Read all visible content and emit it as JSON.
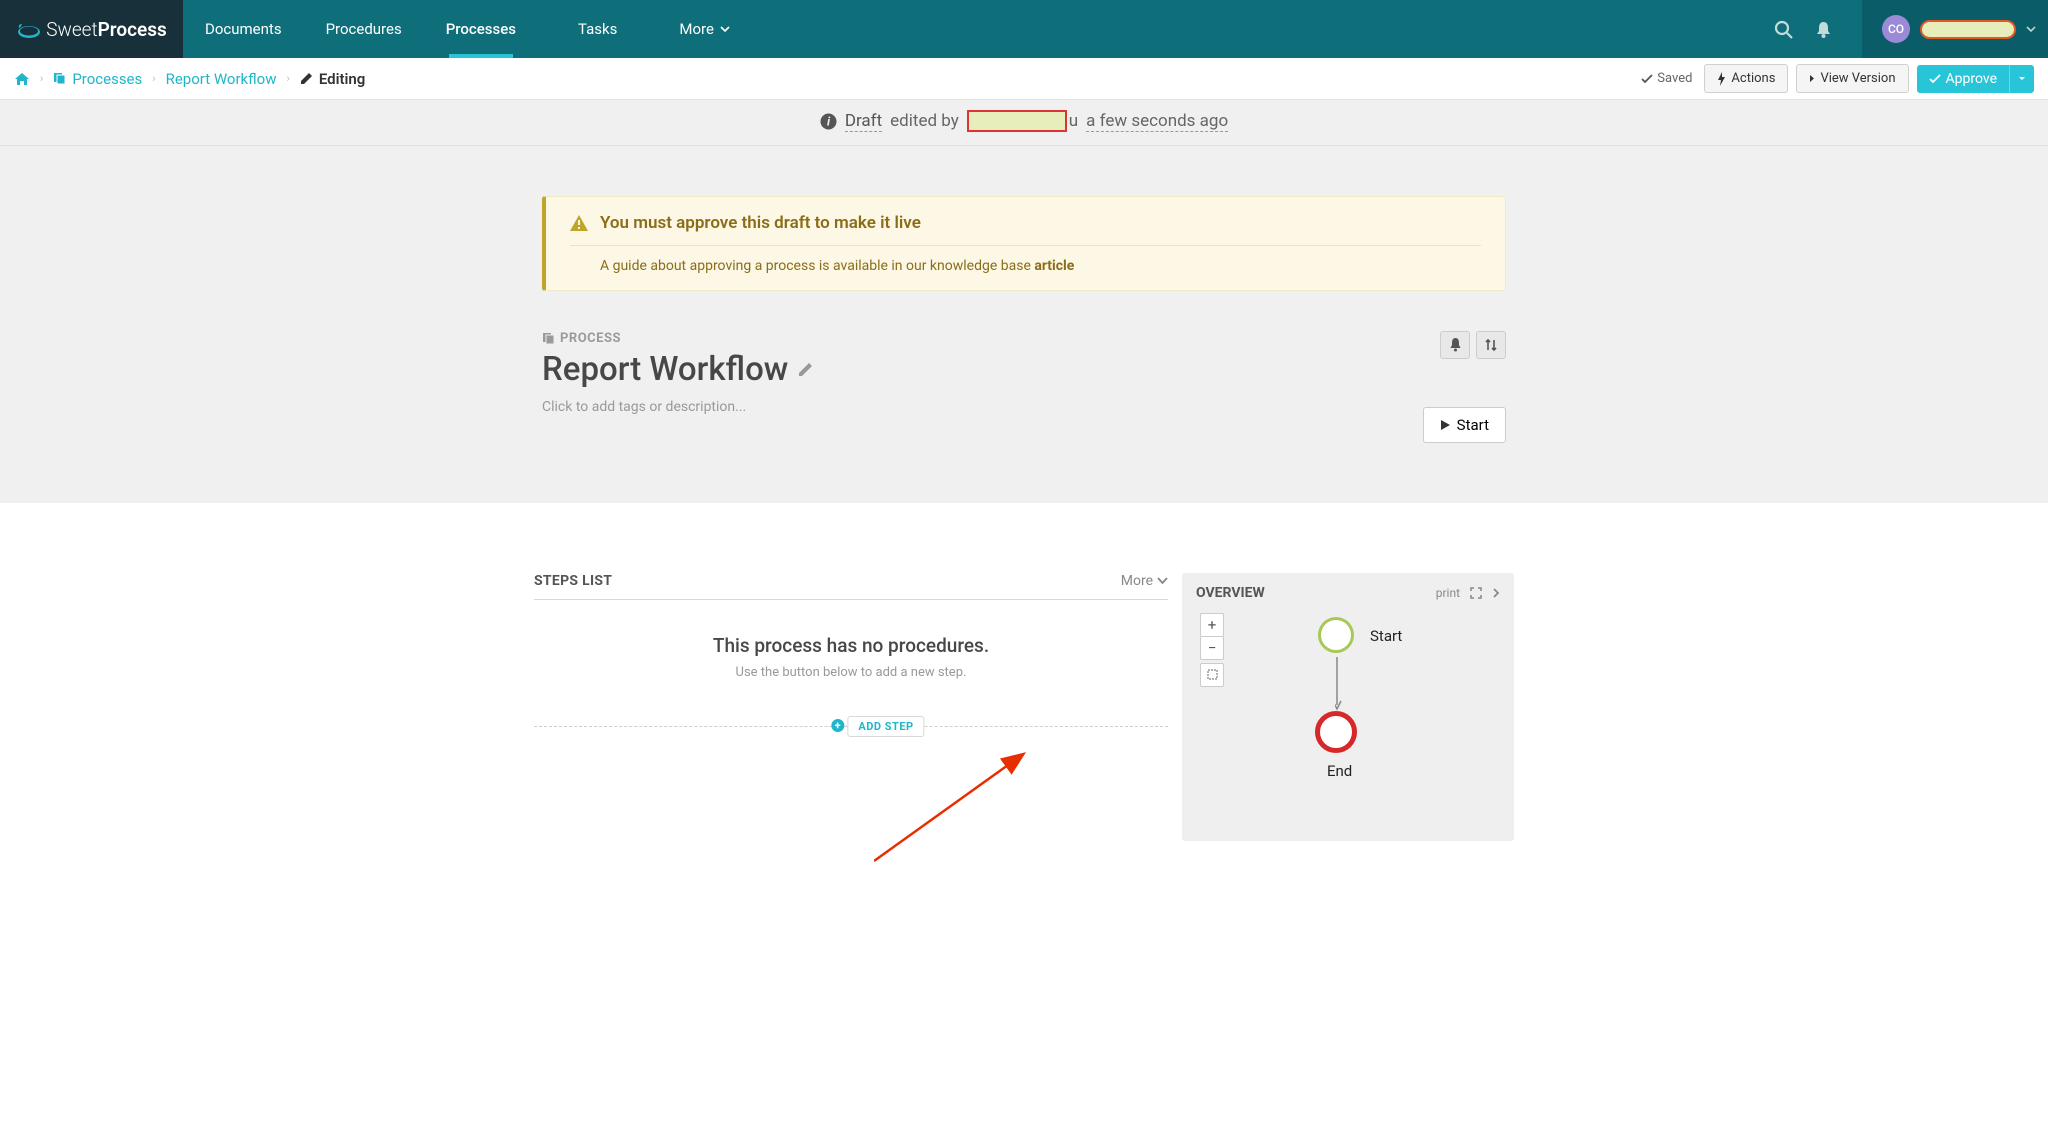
{
  "brand": {
    "name_light": "Sweet",
    "name_bold": "Process"
  },
  "nav": {
    "items": [
      {
        "label": "Documents"
      },
      {
        "label": "Procedures"
      },
      {
        "label": "Processes",
        "active": true
      },
      {
        "label": "Tasks"
      },
      {
        "label": "More"
      }
    ]
  },
  "user": {
    "initials": "CO"
  },
  "breadcrumb": {
    "processes": "Processes",
    "workflow": "Report Workflow",
    "current": "Editing"
  },
  "toolbar": {
    "saved": "Saved",
    "actions": "Actions",
    "view_version": "View Version",
    "approve": "Approve"
  },
  "draft_bar": {
    "draft": "Draft",
    "edited_by": "edited by",
    "trailing_char": "u",
    "timestamp": "a few seconds ago"
  },
  "alert": {
    "title": "You must approve this draft to make it live",
    "body_prefix": "A guide about approving a process is available in our knowledge base ",
    "body_link": "article"
  },
  "process": {
    "label": "PROCESS",
    "title": "Report Workflow",
    "desc_placeholder": "Click to add tags or description...",
    "start_btn": "Start"
  },
  "steps": {
    "heading": "STEPS LIST",
    "more": "More",
    "empty_title": "This process has no procedures.",
    "empty_sub": "Use the button below to add a new step.",
    "add_step": "ADD STEP"
  },
  "overview": {
    "heading": "OVERVIEW",
    "print": "print",
    "node_start": "Start",
    "node_end": "End"
  }
}
